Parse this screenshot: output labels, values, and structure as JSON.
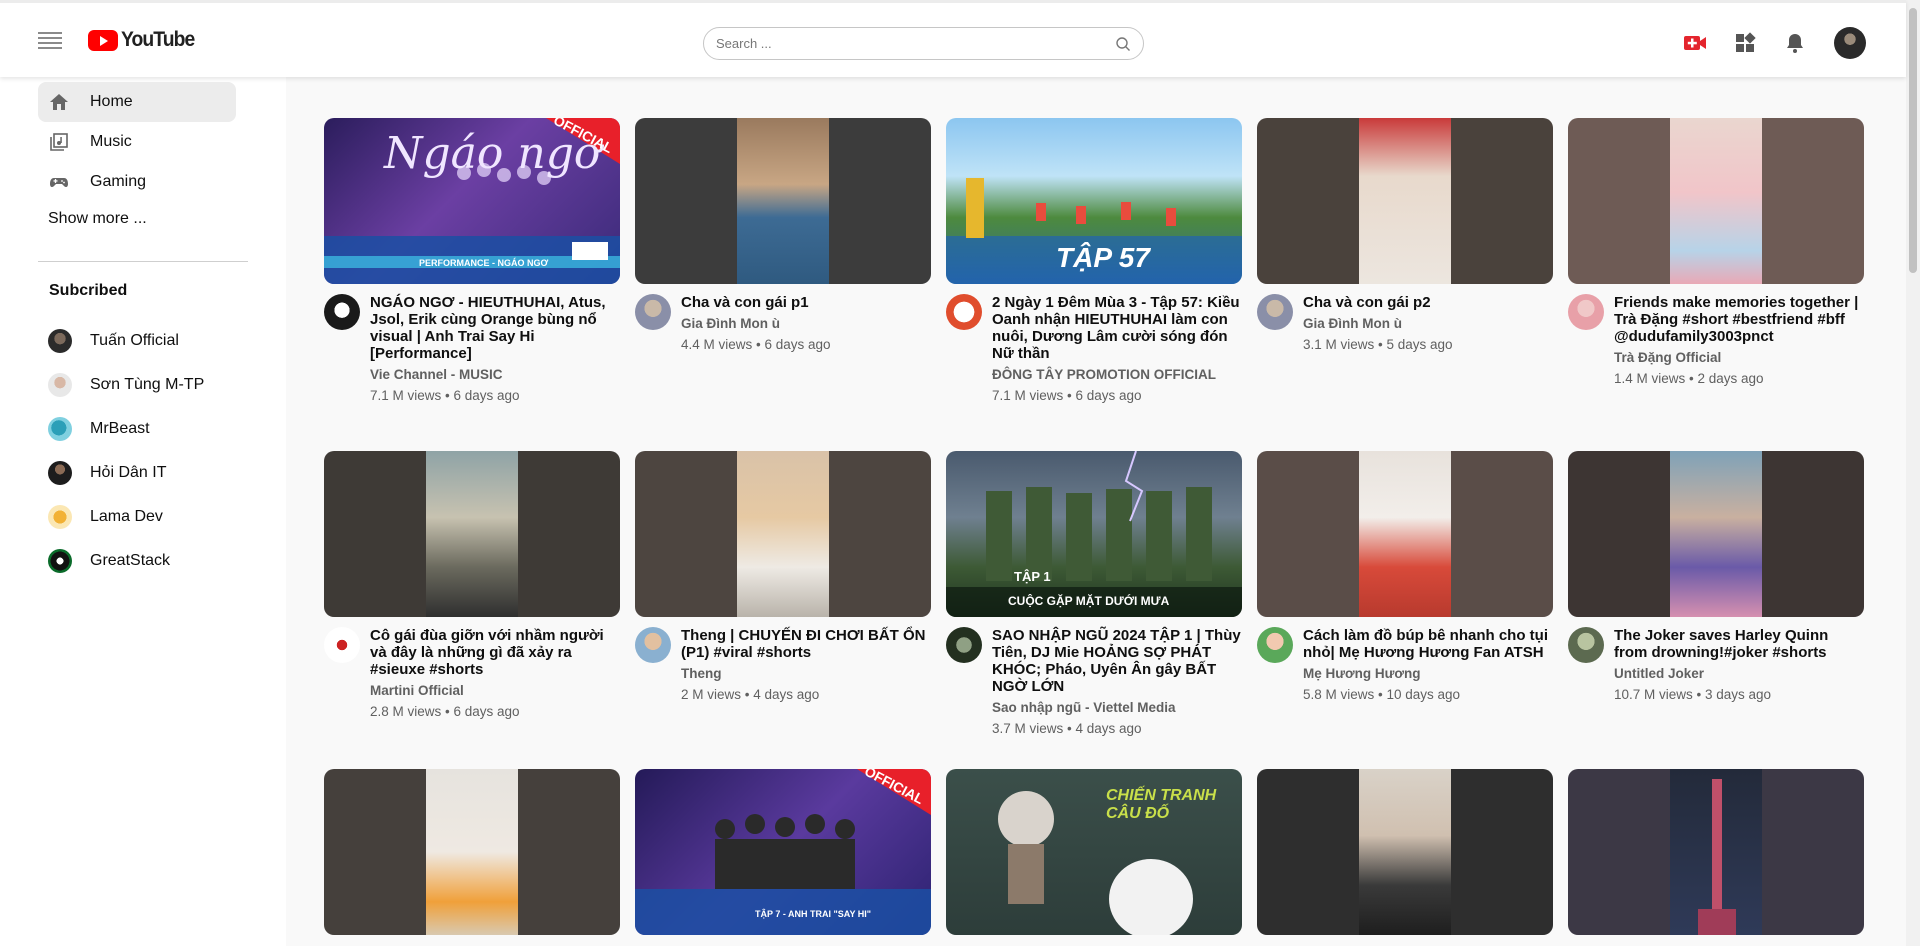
{
  "header": {
    "logo_text": "YouTube",
    "search_placeholder": "Search ..."
  },
  "sidebar": {
    "nav": [
      {
        "label": "Home",
        "icon": "home-icon"
      },
      {
        "label": "Music",
        "icon": "music-library-icon"
      },
      {
        "label": "Gaming",
        "icon": "gamepad-icon"
      }
    ],
    "show_more": "Show more ...",
    "subscribed_title": "Subcribed",
    "subscriptions": [
      {
        "name": "Tuấn Official"
      },
      {
        "name": "Sơn Tùng M-TP"
      },
      {
        "name": "MrBeast"
      },
      {
        "name": "Hỏi Dân IT"
      },
      {
        "name": "Lama Dev"
      },
      {
        "name": "GreatStack"
      }
    ]
  },
  "videos": [
    {
      "title": "NGÁO NGƠ - HIEUTHUHAI, Atus, Jsol, Erik cùng Orange bùng nổ visual | Anh Trai Say Hi [Performance]",
      "channel": "Vie Channel - MUSIC",
      "stats": "7.1 M views • 6 days ago",
      "thumb_text": "Ngáo ngơ",
      "badge": "OFFICIAL",
      "strip": "PERFORMANCE - NGÁO NGƠ"
    },
    {
      "title": "Cha và con gái p1",
      "channel": "Gia Đình Mon ù",
      "stats": "4.4 M views • 6 days ago"
    },
    {
      "title": "2 Ngày 1 Đêm Mùa 3 - Tập 57: Kiều Oanh nhận HIEUTHUHAI làm con nuôi, Dương Lâm cười sóng đón Nữ thần",
      "channel": "ĐÔNG TÂY PROMOTION OFFICIAL",
      "stats": "7.1 M views • 6 days ago",
      "thumb_text": "TẬP 57"
    },
    {
      "title": "Cha và con gái p2",
      "channel": "Gia Đình Mon ù",
      "stats": "3.1 M views • 5 days ago"
    },
    {
      "title": "Friends make memories together | Trà Đặng #short #bestfriend #bff @dudufamily3003pnct",
      "channel": "Trà Đặng Official",
      "stats": "1.4 M views • 2 days ago"
    },
    {
      "title": "Cô gái đùa giỡn với nhầm người và đây là những gì đã xảy ra #sieuxe #shorts",
      "channel": "Martini Official",
      "stats": "2.8 M views • 6 days ago"
    },
    {
      "title": "Theng | CHUYẾN ĐI CHƠI BẤT ỔN (P1) #viral #shorts",
      "channel": "Theng",
      "stats": "2 M views • 4 days ago"
    },
    {
      "title": "SAO NHẬP NGŨ 2024 TẬP 1 | Thùy Tiên, DJ Mie HOẢNG SỢ PHÁT KHÓC; Pháo, Uyên Ân gây BẤT NGỜ LỚN",
      "channel": "Sao nhập ngũ - Viettel Media",
      "stats": "3.7 M views • 4 days ago",
      "thumb_text": "TẬP 1",
      "strip": "CUỘC GẶP MẶT DƯỚI MƯA"
    },
    {
      "title": "Cách làm đồ búp bê nhanh cho tụi nhỏ| Mẹ Hương Hương Fan ATSH",
      "channel": "Mẹ Hương Hương",
      "stats": "5.8 M views • 10 days ago"
    },
    {
      "title": "The Joker saves Harley Quinn from drowning!#joker #shorts",
      "channel": "Untitled Joker",
      "stats": "10.7 M views • 3 days ago"
    },
    {
      "title": "",
      "channel": "",
      "stats": ""
    },
    {
      "title": "",
      "channel": "",
      "stats": "",
      "badge": "OFFICIAL",
      "strip": "TẬP 7 - ANH TRAI \"SAY HI\""
    },
    {
      "title": "",
      "channel": "",
      "stats": "",
      "thumb_text": "CHIẾN TRANH CÂU ĐỐ"
    },
    {
      "title": "",
      "channel": "",
      "stats": ""
    },
    {
      "title": "",
      "channel": "",
      "stats": ""
    }
  ],
  "colors": {
    "brand_red": "#ff0000",
    "active_bg": "#ececec",
    "meta_text": "#606060"
  }
}
